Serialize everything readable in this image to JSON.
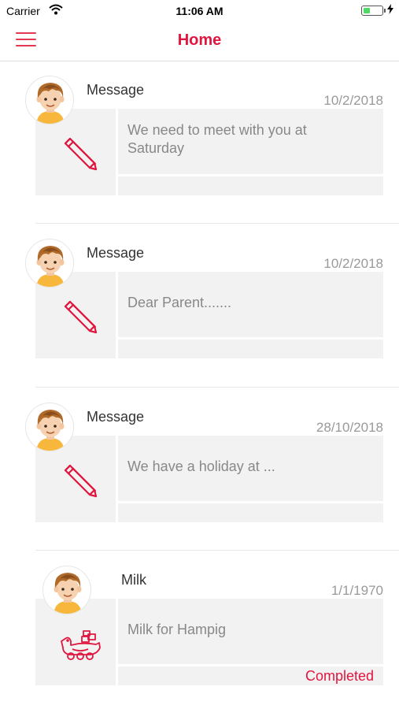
{
  "status_bar": {
    "carrier": "Carrier",
    "time": "11:06 AM",
    "battery_level": 0.35
  },
  "nav": {
    "title": "Home",
    "menu_icon": "hamburger-menu-icon"
  },
  "colors": {
    "accent": "#e0163f",
    "block_bg": "#f2f2f2",
    "muted_text": "#999999"
  },
  "cards": [
    {
      "type": "Message",
      "date": "10/2/2018",
      "text": "We need to meet with you at Saturday",
      "icon": "pencil-icon",
      "status": ""
    },
    {
      "type": "Message",
      "date": "10/2/2018",
      "text": "Dear Parent.......",
      "icon": "pencil-icon",
      "status": ""
    },
    {
      "type": "Message",
      "date": "28/10/2018",
      "text": "We have a holiday at ...",
      "icon": "pencil-icon",
      "status": ""
    },
    {
      "type": "Milk",
      "date": "1/1/1970",
      "text": "Milk for Hampig",
      "icon": "toy-duck-icon",
      "status": "Completed"
    }
  ]
}
